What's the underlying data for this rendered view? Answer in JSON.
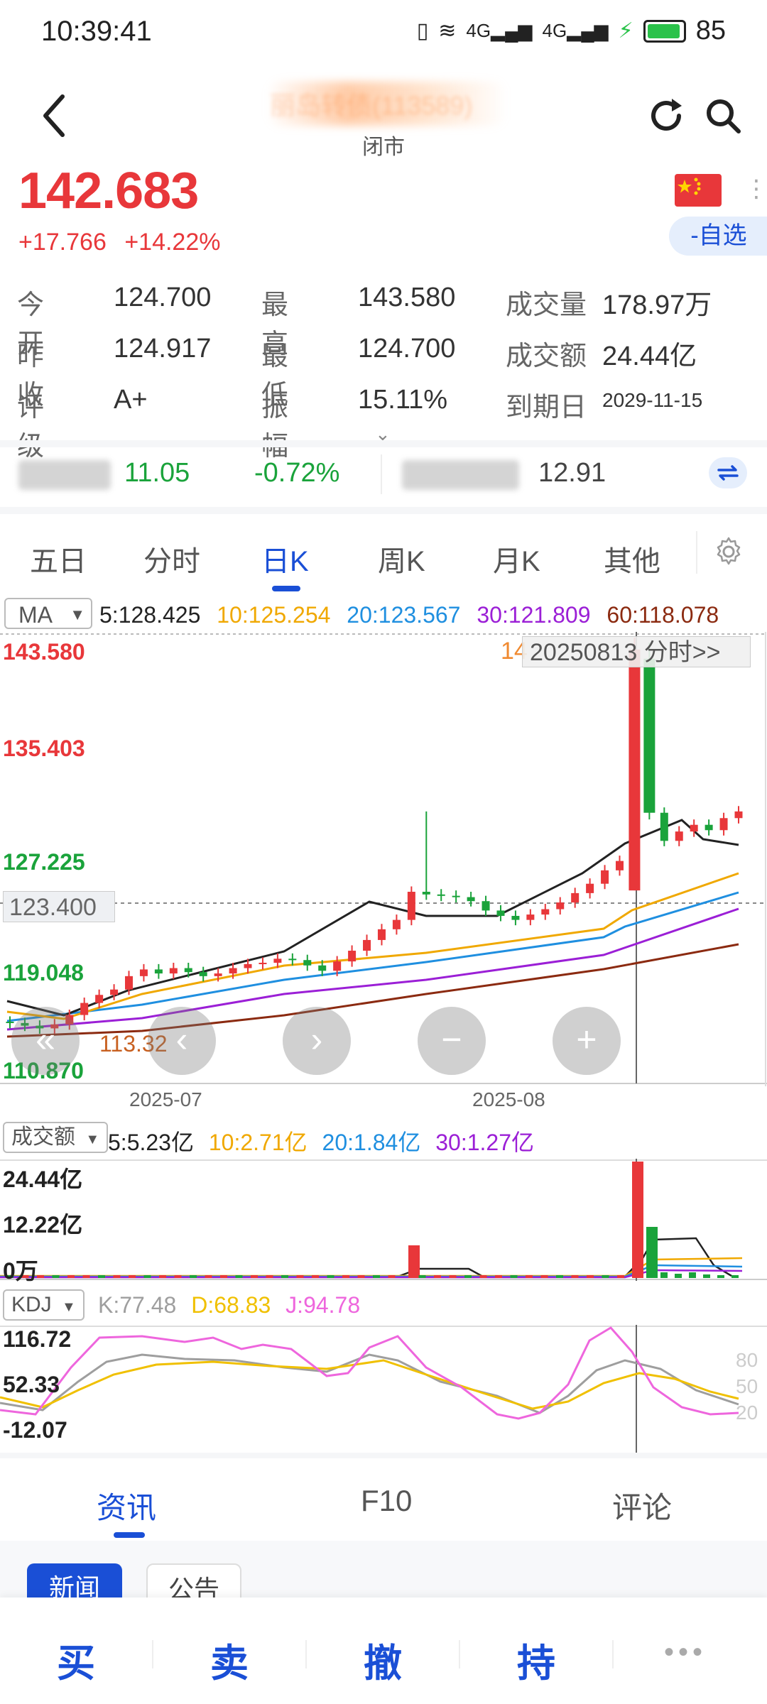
{
  "status_bar": {
    "time": "10:39:41",
    "battery": "85",
    "network": "4G"
  },
  "header": {
    "title": "丽岛转债(113589)",
    "subtitle": "闭市"
  },
  "quote": {
    "price": "142.683",
    "change": "+17.766",
    "change_pct": "+14.22%",
    "watch_label": "-自选",
    "rows": [
      [
        {
          "label": "今 开",
          "value": "124.700"
        },
        {
          "label": "最 高",
          "value": "143.580"
        },
        {
          "label": "成交量",
          "value": "178.97万"
        }
      ],
      [
        {
          "label": "昨 收",
          "value": "124.917"
        },
        {
          "label": "最 低",
          "value": "124.700"
        },
        {
          "label": "成交额",
          "value": "24.44亿"
        }
      ],
      [
        {
          "label": "评 级",
          "value": "A+"
        },
        {
          "label": "振 幅",
          "value": "15.11%"
        },
        {
          "label": "到期日",
          "value": "2029-11-15"
        }
      ]
    ]
  },
  "ticker": {
    "v1": "11.05",
    "p1": "-0.72%",
    "v2": "12.91"
  },
  "tabs": [
    "五日",
    "分时",
    "日K",
    "周K",
    "月K",
    "其他"
  ],
  "active_tab": "日K",
  "ma": {
    "selector": "MA",
    "items": [
      {
        "label": "5:128.425",
        "color": "#222222"
      },
      {
        "label": "10:125.254",
        "color": "#f0a800"
      },
      {
        "label": "20:123.567",
        "color": "#1f8fe0"
      },
      {
        "label": "30:121.809",
        "color": "#9b1fd6"
      },
      {
        "label": "60:118.078",
        "color": "#8b2a10"
      }
    ]
  },
  "kline_axis": {
    "y_labels": [
      "143.580",
      "135.403",
      "127.225",
      "123.400",
      "119.048",
      "110.870"
    ],
    "x_labels": [
      "2025-07",
      "2025-08"
    ],
    "tip": "20250813 分时>>",
    "high_prefix": "14",
    "low_marker": "113.32"
  },
  "volume": {
    "selector": "成交额",
    "items": [
      {
        "label": "5:5.23亿",
        "color": "#222222"
      },
      {
        "label": "10:2.71亿",
        "color": "#f0a800"
      },
      {
        "label": "20:1.84亿",
        "color": "#1f8fe0"
      },
      {
        "label": "30:1.27亿",
        "color": "#9b1fd6"
      }
    ],
    "y_labels": [
      "24.44亿",
      "12.22亿",
      "0万"
    ]
  },
  "kdj": {
    "selector": "KDJ",
    "items": [
      {
        "label": "K:77.48",
        "color": "#9e9e9e"
      },
      {
        "label": "D:68.83",
        "color": "#f0c000"
      },
      {
        "label": "J:94.78",
        "color": "#ee66dd"
      }
    ],
    "y_labels": [
      "116.72",
      "52.33",
      "-12.07"
    ],
    "ref_levels": [
      "80",
      "50",
      "20"
    ]
  },
  "bottom_tabs": [
    "资讯",
    "F10",
    "评论"
  ],
  "chips": [
    "新闻",
    "公告"
  ],
  "actions": [
    "买",
    "卖",
    "撤",
    "持"
  ],
  "colors": {
    "up": "#e8373a",
    "down": "#1aa33b",
    "accent": "#1a4fd6"
  }
}
